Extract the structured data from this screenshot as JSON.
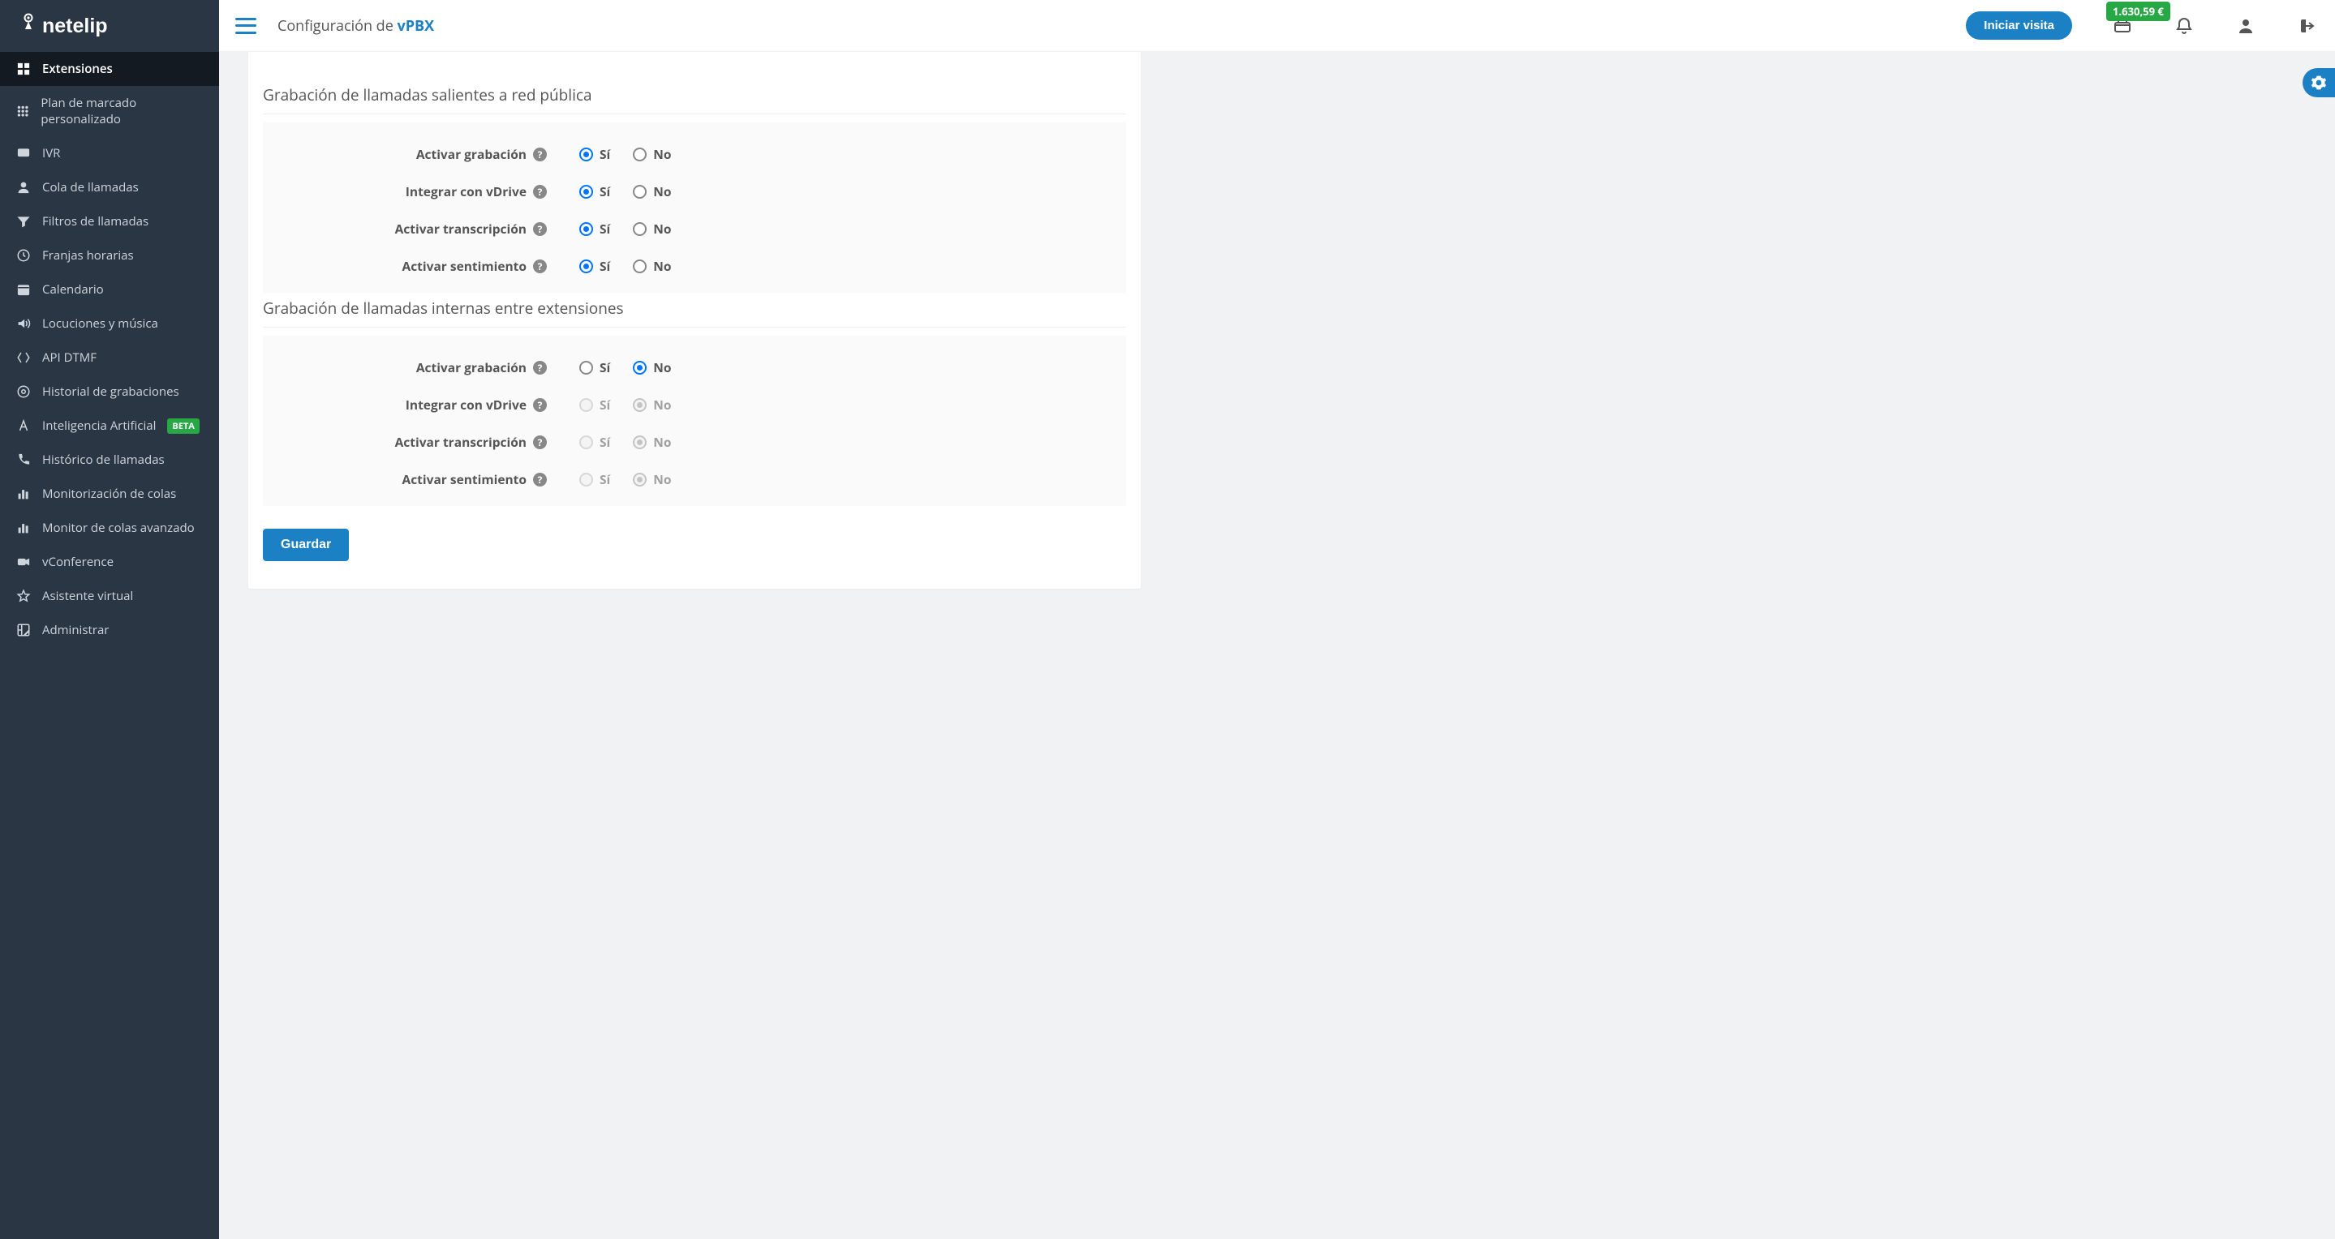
{
  "brand": "netelip",
  "header": {
    "title_prefix": "Configuración de ",
    "title_accent": "vPBX",
    "visit_button": "Iniciar visita",
    "balance": "1.630,59 €"
  },
  "sidebar": {
    "items": [
      {
        "label": "Extensiones",
        "icon": "extensions",
        "active": true
      },
      {
        "label": "Plan de marcado personalizado",
        "icon": "dialplan"
      },
      {
        "label": "IVR",
        "icon": "ivr"
      },
      {
        "label": "Cola de llamadas",
        "icon": "queue"
      },
      {
        "label": "Filtros de llamadas",
        "icon": "filter"
      },
      {
        "label": "Franjas horarias",
        "icon": "clock"
      },
      {
        "label": "Calendario",
        "icon": "calendar"
      },
      {
        "label": "Locuciones y música",
        "icon": "audio"
      },
      {
        "label": "API DTMF",
        "icon": "api"
      },
      {
        "label": "Historial de grabaciones",
        "icon": "history"
      },
      {
        "label": "Inteligencia Artificial",
        "icon": "ai",
        "beta": "BETA"
      },
      {
        "label": "Histórico de llamadas",
        "icon": "phone"
      },
      {
        "label": "Monitorización de colas",
        "icon": "bars"
      },
      {
        "label": "Monitor de colas avanzado",
        "icon": "bars"
      },
      {
        "label": "vConference",
        "icon": "video"
      },
      {
        "label": "Asistente virtual",
        "icon": "star"
      },
      {
        "label": "Administrar",
        "icon": "admin"
      }
    ]
  },
  "form": {
    "yes_label": "Sí",
    "no_label": "No",
    "sections": [
      {
        "title": "Grabación de llamadas salientes a red pública",
        "rows": [
          {
            "label": "Activar grabación",
            "value": "yes",
            "disabled": false
          },
          {
            "label": "Integrar con vDrive",
            "value": "yes",
            "disabled": false
          },
          {
            "label": "Activar transcripción",
            "value": "yes",
            "disabled": false
          },
          {
            "label": "Activar sentimiento",
            "value": "yes",
            "disabled": false
          }
        ]
      },
      {
        "title": "Grabación de llamadas internas entre extensiones",
        "rows": [
          {
            "label": "Activar grabación",
            "value": "no",
            "disabled": false
          },
          {
            "label": "Integrar con vDrive",
            "value": "no",
            "disabled": true
          },
          {
            "label": "Activar transcripción",
            "value": "no",
            "disabled": true
          },
          {
            "label": "Activar sentimiento",
            "value": "no",
            "disabled": true
          }
        ]
      }
    ],
    "save_label": "Guardar"
  }
}
